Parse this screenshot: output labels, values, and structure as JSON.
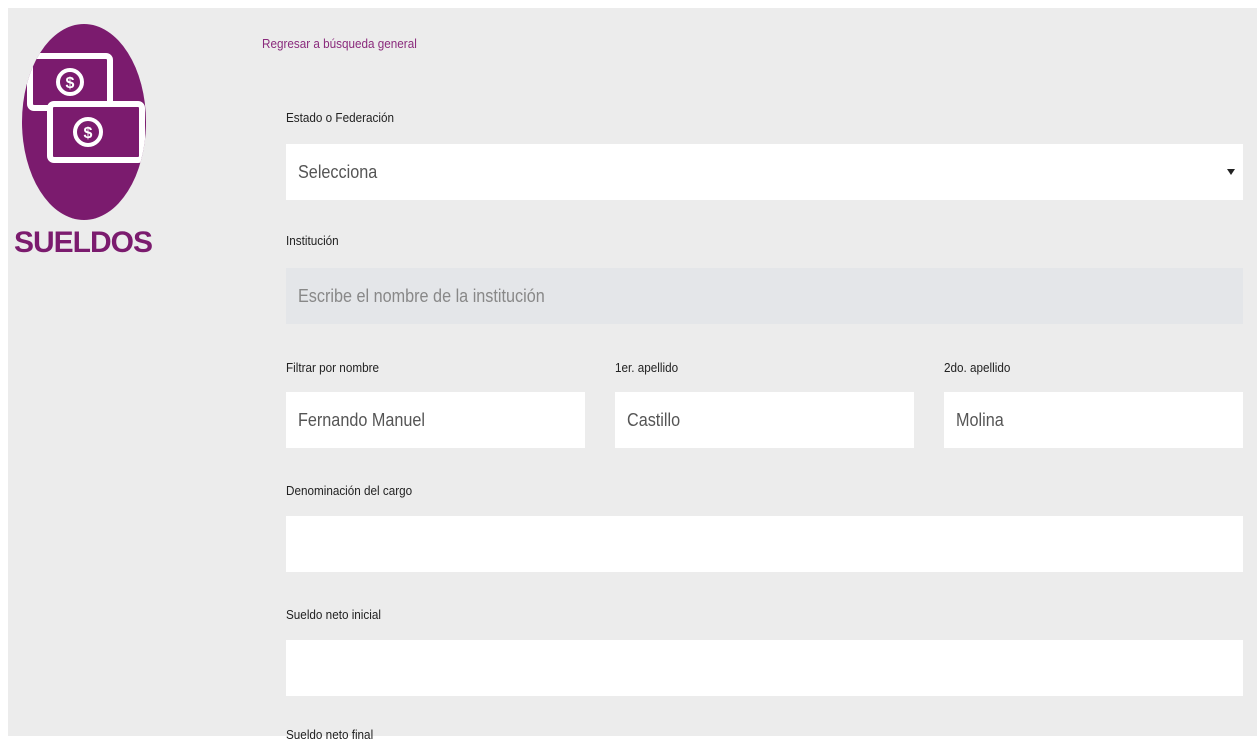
{
  "sidebar": {
    "title": "SUELDOS",
    "logo_icon": "money-bills-icon",
    "logo_color": "#7b1b6e"
  },
  "back_link": "Regresar a búsqueda general",
  "form": {
    "estado": {
      "label": "Estado o Federación",
      "value": "Selecciona"
    },
    "institucion": {
      "label": "Institución",
      "placeholder": "Escribe el nombre de la institución"
    },
    "nombre": {
      "label": "Filtrar por nombre",
      "value": "Fernando Manuel"
    },
    "apellido1": {
      "label": "1er. apellido",
      "value": "Castillo"
    },
    "apellido2": {
      "label": "2do. apellido",
      "value": "Molina"
    },
    "cargo": {
      "label": "Denominación del cargo",
      "value": ""
    },
    "sueldo_inicial": {
      "label": "Sueldo neto inicial",
      "value": ""
    },
    "sueldo_final": {
      "label": "Sueldo neto final"
    }
  }
}
